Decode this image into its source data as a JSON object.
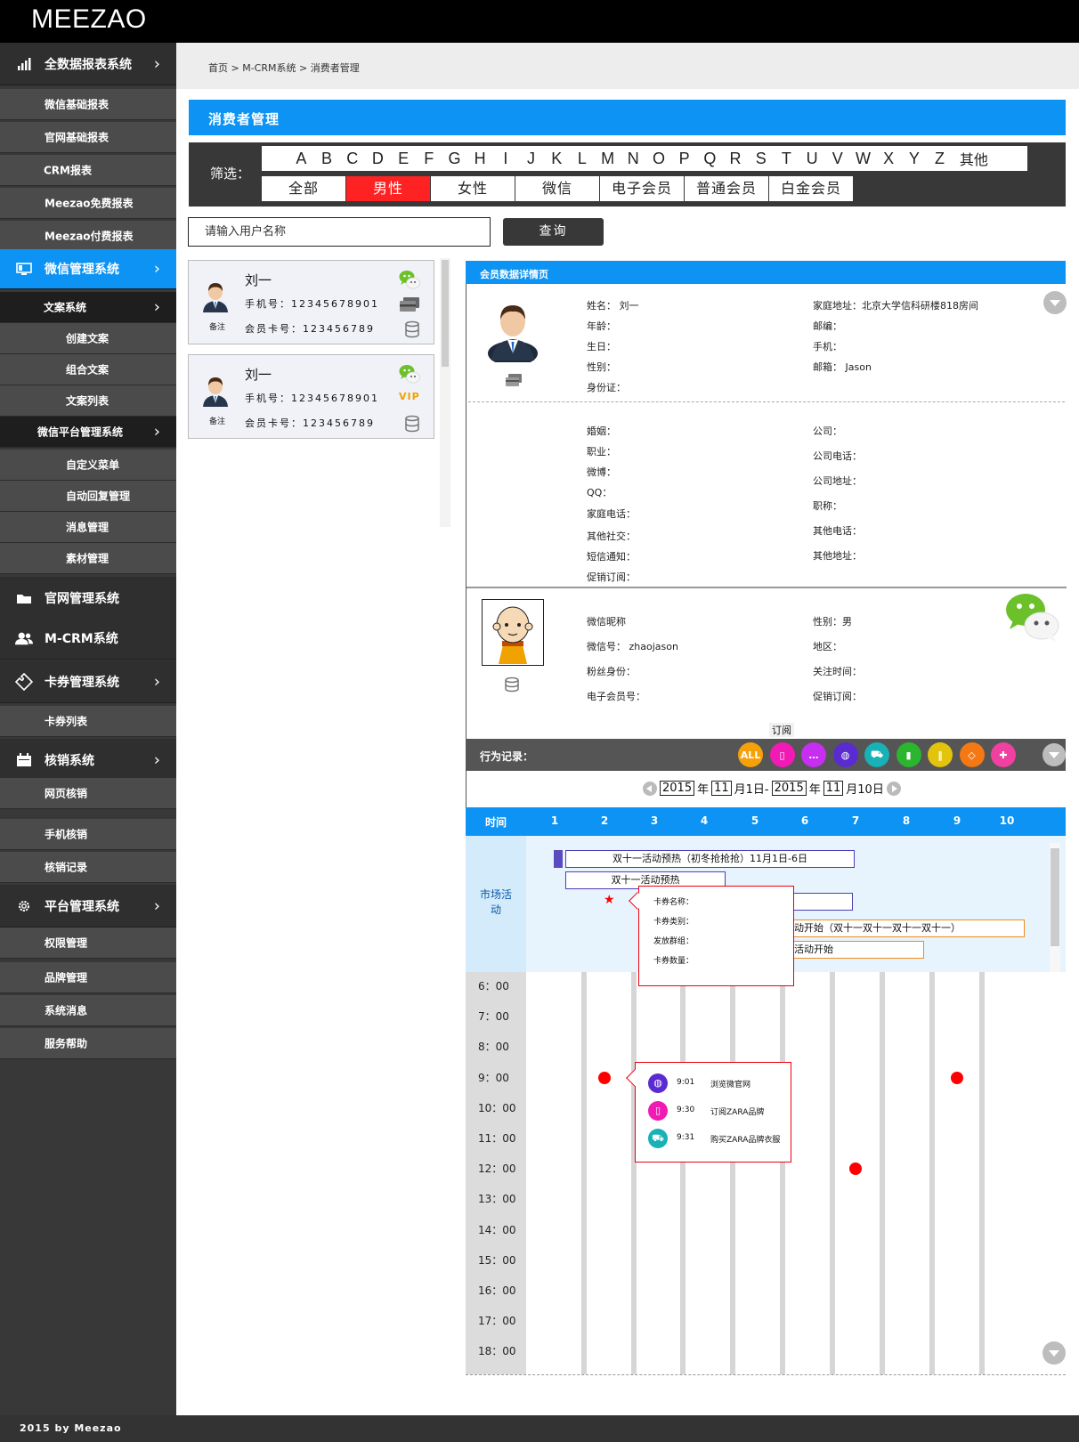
{
  "app": {
    "logo": "MEEZAO",
    "footer": "2015 by Meezao"
  },
  "sidebar": {
    "items": [
      {
        "label": "全数据报表系统",
        "type": "main",
        "icon": "bar-chart-icon",
        "chevron": true
      },
      {
        "label": "微信基础报表",
        "type": "sub"
      },
      {
        "label": "官网基础报表",
        "type": "sub"
      },
      {
        "label": "CRM报表",
        "type": "sub"
      },
      {
        "label": "Meezao免费报表",
        "type": "sub"
      },
      {
        "label": "Meezao付费报表",
        "type": "sub"
      },
      {
        "label": "微信管理系统",
        "type": "main-active",
        "icon": "monitor-icon",
        "chevron": true
      },
      {
        "label": "文案系统",
        "type": "group",
        "chevron": true
      },
      {
        "label": "创建文案",
        "type": "subsub"
      },
      {
        "label": "组合文案",
        "type": "subsub"
      },
      {
        "label": "文案列表",
        "type": "subsub"
      },
      {
        "label": "微信平台管理系统",
        "type": "group",
        "chevron": true
      },
      {
        "label": "自定义菜单",
        "type": "subsub"
      },
      {
        "label": "自动回复管理",
        "type": "subsub"
      },
      {
        "label": "消息管理",
        "type": "subsub"
      },
      {
        "label": "素材管理",
        "type": "subsub"
      },
      {
        "label": "官网管理系统",
        "type": "main",
        "icon": "folder-icon"
      },
      {
        "label": "M-CRM系统",
        "type": "main",
        "icon": "users-icon"
      },
      {
        "label": "卡券管理系统",
        "type": "main",
        "icon": "ticket-icon",
        "chevron": true
      },
      {
        "label": "卡券列表",
        "type": "sub"
      },
      {
        "label": "核销系统",
        "type": "main",
        "icon": "calendar-icon",
        "chevron": true
      },
      {
        "label": "网页核销",
        "type": "sub"
      },
      {
        "label": "手机核销",
        "type": "sub"
      },
      {
        "label": "核销记录",
        "type": "sub"
      },
      {
        "label": "平台管理系统",
        "type": "main",
        "icon": "gear-icon",
        "chevron": true
      },
      {
        "label": "权限管理",
        "type": "sub"
      },
      {
        "label": "品牌管理",
        "type": "sub"
      },
      {
        "label": "系统消息",
        "type": "sub"
      },
      {
        "label": "服务帮助",
        "type": "sub"
      }
    ]
  },
  "breadcrumb": "首页 > M-CRM系统 > 消费者管理",
  "page_title": "消费者管理",
  "filter": {
    "label": "筛选：",
    "letters": [
      "A",
      "B",
      "C",
      "D",
      "E",
      "F",
      "G",
      "H",
      "I",
      "J",
      "K",
      "L",
      "M",
      "N",
      "O",
      "P",
      "Q",
      "R",
      "S",
      "T",
      "U",
      "V",
      "W",
      "X",
      "Y",
      "Z"
    ],
    "other": "其他",
    "categories": [
      "全部",
      "男性",
      "女性",
      "微信",
      "电子会员",
      "普通会员",
      "白金会员"
    ],
    "selected": "男性"
  },
  "search": {
    "placeholder": "请输入用户名称",
    "button": "查询"
  },
  "members": [
    {
      "name": "刘一",
      "phone": "手机号：12345678901",
      "card": "会员卡号：123456789",
      "note": "备注",
      "vip": ""
    },
    {
      "name": "刘一",
      "phone": "手机号：12345678901",
      "card": "会员卡号：123456789",
      "note": "备注",
      "vip": "VIP"
    }
  ],
  "detail": {
    "header": "会员数据详情页",
    "basic_left": [
      "姓名：  刘一",
      "年龄：",
      "生日：",
      "性别：",
      "身份证："
    ],
    "basic_right": [
      "家庭地址：北京大学信科研楼818房间",
      "邮编：",
      "手机：",
      "邮箱：  Jason"
    ],
    "extra_left": [
      "婚姻：",
      "职业：",
      "微博：",
      "QQ：",
      "家庭电话：",
      "其他社交：",
      "短信通知：",
      "促销订阅："
    ],
    "extra_right": [
      "公司：",
      "公司电话：",
      "公司地址：",
      "职称：",
      "其他电话：",
      "其他地址："
    ],
    "wechat_left": [
      "微信昵称",
      "微信号：   zhaojason",
      "粉丝身份：",
      "电子会员号："
    ],
    "wechat_right": [
      "性别：男",
      "地区：",
      "关注时间：",
      "促销订阅："
    ],
    "subscribe_tag": "订阅"
  },
  "behavior": {
    "label": "行为记录：",
    "all_label": "ALL",
    "icons": [
      "all-icon",
      "phone-icon",
      "chat-icon",
      "globe-icon",
      "cart-icon",
      "signal-icon",
      "barcode-icon",
      "tag-icon",
      "gamepad-icon"
    ],
    "icon_colors": [
      "#f7a10a",
      "#f11ab4",
      "#c72ff0",
      "#5a2bd0",
      "#17b1b6",
      "#2cb52e",
      "#e3c40d",
      "#f47915",
      "#f040a0"
    ],
    "date": {
      "y1": "2015",
      "m1": "11",
      "d1": "月1日-",
      "y2": "2015",
      "m2": "11",
      "d2": "月10日"
    },
    "year_char": "年"
  },
  "timeline": {
    "col_label": "时间",
    "days": [
      "1",
      "2",
      "3",
      "4",
      "5",
      "6",
      "7",
      "8",
      "9",
      "10"
    ],
    "market_label": "市场活动",
    "events": [
      {
        "text": "双十一活动预热（初冬抢抢抢）11月1日-6日",
        "color": "#4a3fb4"
      },
      {
        "text": "双十一活动预热",
        "color": "#4a3fb4"
      },
      {
        "text": "抢",
        "color": "#4a3fb4"
      },
      {
        "text": "十一活动开始（双十一双十一双十一双十一）",
        "color": "#f08a1c"
      },
      {
        "text": "双十一活动开始",
        "color": "#f08a1c"
      }
    ],
    "hours": [
      "6：00",
      "7：00",
      "8：00",
      "9：00",
      "10：00",
      "11：00",
      "12：00",
      "13：00",
      "14：00",
      "15：00",
      "16：00",
      "17：00",
      "18：00"
    ],
    "card_tip": [
      "卡券名称：",
      "卡券类别：",
      "发放群组：",
      "卡券数量："
    ],
    "activity_tip": [
      {
        "time": "9:01",
        "text": "浏览微官网",
        "icon": "globe-icon",
        "color": "#5a2bd0"
      },
      {
        "time": "9:30",
        "text": "订阅ZARA品牌",
        "icon": "phone-icon",
        "color": "#f11ab4"
      },
      {
        "time": "9:31",
        "text": "购买ZARA品牌衣服",
        "icon": "cart-icon",
        "color": "#17b1b6"
      }
    ],
    "dots": [
      {
        "day": 2,
        "hour": "9:00"
      },
      {
        "day": 9,
        "hour": "9:00"
      },
      {
        "day": 7,
        "hour": "12:00"
      }
    ]
  }
}
